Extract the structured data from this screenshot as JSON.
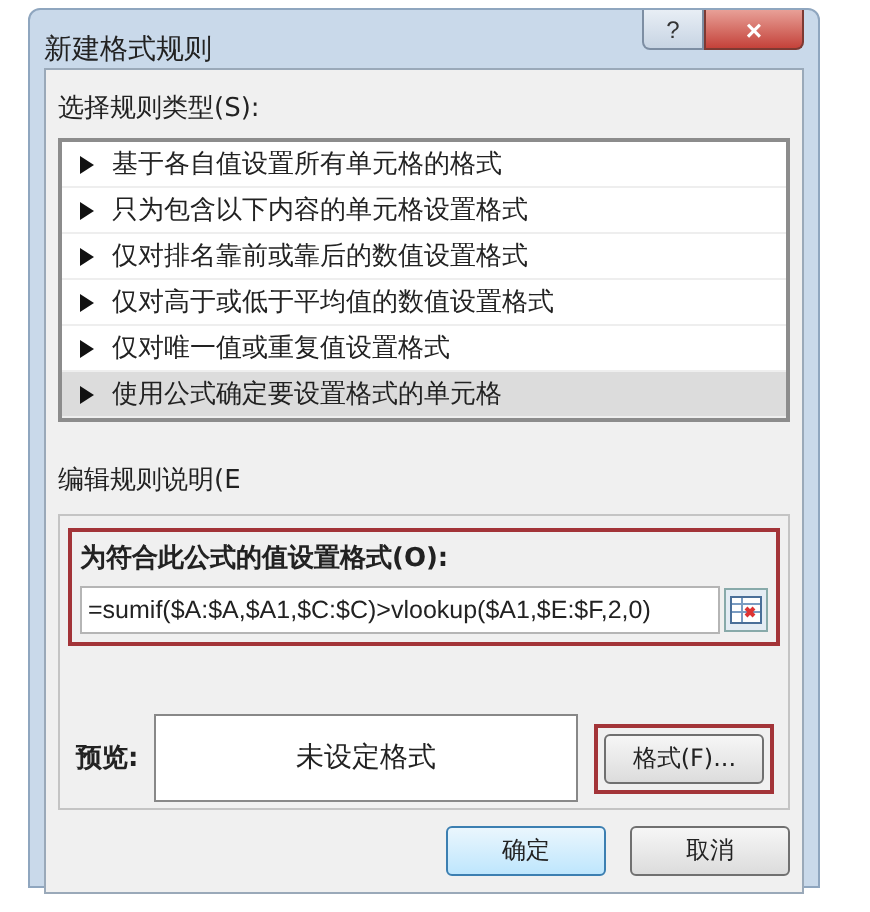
{
  "window": {
    "title": "新建格式规则",
    "help_button": "?",
    "close_button": "×"
  },
  "rule_type": {
    "label": "选择规则类型(S):",
    "items": [
      {
        "text": "基于各自值设置所有单元格的格式",
        "selected": false
      },
      {
        "text": "只为包含以下内容的单元格设置格式",
        "selected": false
      },
      {
        "text": "仅对排名靠前或靠后的数值设置格式",
        "selected": false
      },
      {
        "text": "仅对高于或低于平均值的数值设置格式",
        "selected": false
      },
      {
        "text": "仅对唯一值或重复值设置格式",
        "selected": false
      },
      {
        "text": "使用公式确定要设置格式的单元格",
        "selected": true
      }
    ]
  },
  "description": {
    "label": "编辑规则说明(E",
    "formula_label": "为符合此公式的值设置格式(O):",
    "formula": "=sumif($A:$A,$A1,$C:$C)>vlookup($A1,$E:$F,2,0)",
    "preview_label": "预览:",
    "preview_text": "未设定格式",
    "format_button": "格式(F)..."
  },
  "buttons": [
    "确定",
    "取消"
  ]
}
